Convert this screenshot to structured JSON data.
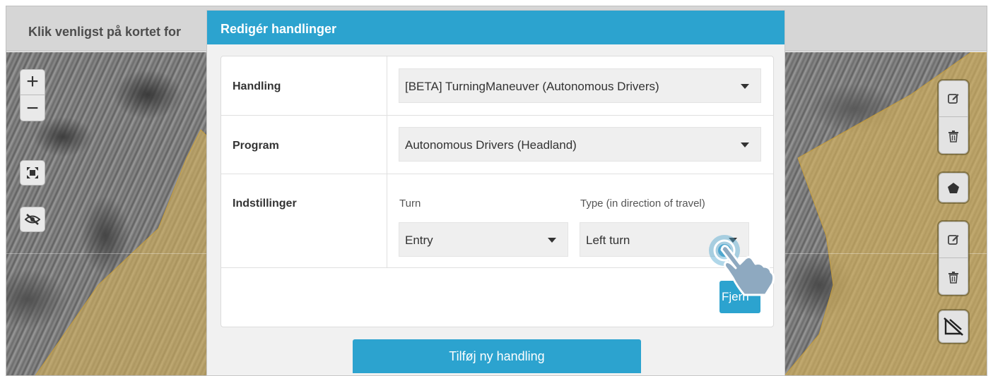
{
  "topbar": {
    "hint": "Klik venligst på kortet for"
  },
  "map_controls": {
    "zoom_in": "+",
    "zoom_out": "−"
  },
  "modal": {
    "title": "Redigér handlinger",
    "rows": {
      "action": {
        "label": "Handling",
        "value": "[BETA] TurningManeuver (Autonomous Drivers)"
      },
      "program": {
        "label": "Program",
        "value": "Autonomous Drivers (Headland)"
      },
      "settings": {
        "label": "Indstillinger",
        "turn_label": "Turn",
        "turn_value": "Entry",
        "type_label": "Type (in direction of travel)",
        "type_value": "Left turn"
      }
    },
    "remove_button": "Fjern",
    "add_button": "Tilføj ny handling"
  },
  "colors": {
    "header_blue": "#2ca3cf",
    "field_overlay": "#d9b45a"
  },
  "icons": [
    "zoom-in-icon",
    "zoom-out-icon",
    "fit-extent-icon",
    "visibility-off-icon",
    "edit-icon",
    "trash-icon",
    "polygon-icon",
    "split-icon",
    "tap-hand-icon"
  ]
}
